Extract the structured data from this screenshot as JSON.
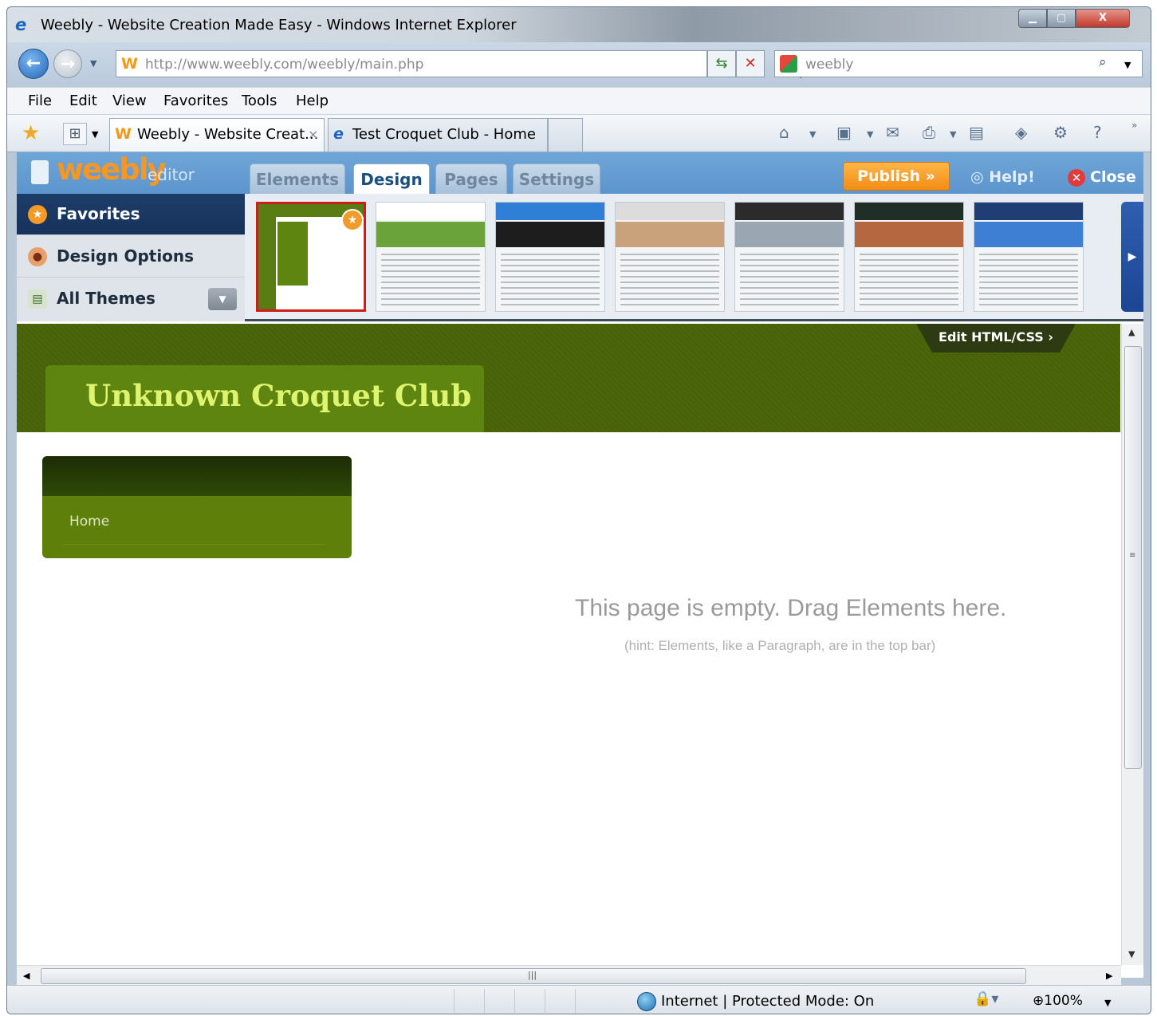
{
  "window": {
    "title": "Weebly - Website Creation Made Easy - Windows Internet Explorer",
    "min_label": "▁",
    "max_label": "▢",
    "close_label": "X"
  },
  "nav": {
    "back_glyph": "←",
    "forward_glyph": "→",
    "address_url": "http://www.weebly.com/weebly/main.php",
    "search_value": "weebly",
    "search_go_glyph": "⌕"
  },
  "menu": {
    "items": [
      "File",
      "Edit",
      "View",
      "Favorites",
      "Tools",
      "Help"
    ]
  },
  "tabs": {
    "tab1_label": "Weebly - Website Creat...",
    "tab1_close": "×",
    "tab2_label": "Test Croquet Club - Home"
  },
  "icons": {
    "favorites": "star-icon",
    "home": "home-icon",
    "feeds": "feeds-icon",
    "mail": "mail-icon",
    "print": "print-icon",
    "page": "page-icon",
    "safety": "safety-icon",
    "tools": "gear-icon",
    "help": "help-icon"
  },
  "weebly": {
    "logo_text": "weebly",
    "logo_suffix": "editor",
    "tabs": [
      "Elements",
      "Design",
      "Pages",
      "Settings"
    ],
    "active_tab": "Design",
    "publish_label": "Publish »",
    "help_label": "Help!",
    "close_label": "Close",
    "side": {
      "favorites_label": "Favorites",
      "design_options_label": "Design Options",
      "all_themes_label": "All Themes"
    },
    "themes": [
      {
        "head": "#5e850f",
        "band": "#5e850f",
        "selected": true
      },
      {
        "head": "#ffffff",
        "band": "#6aa33a",
        "selected": false
      },
      {
        "head": "#2f7fd6",
        "band": "#1d1d1d",
        "selected": false
      },
      {
        "head": "#dcdcdc",
        "band": "#c9a27b",
        "selected": false
      },
      {
        "head": "#2b2b2b",
        "band": "#9aa6b1",
        "selected": false
      },
      {
        "head": "#1f2f28",
        "band": "#b5673f",
        "selected": false
      },
      {
        "head": "#1f3f74",
        "band": "#3e7fd3",
        "selected": false
      }
    ]
  },
  "site": {
    "edit_html_label": "Edit HTML/CSS ›",
    "title": "Unknown Croquet Club",
    "nav_home": "Home",
    "empty_message": "This page is empty. Drag Elements here.",
    "empty_hint": "(hint: Elements, like a Paragraph, are in the top bar)"
  },
  "status": {
    "zone_text": "Internet | Protected Mode: On",
    "zoom_label": "100%"
  },
  "colors": {
    "site_header": "#4b660a",
    "site_title": "#dff46e",
    "publish": "#f08c14",
    "weebly_bar": "#5c95cd"
  }
}
